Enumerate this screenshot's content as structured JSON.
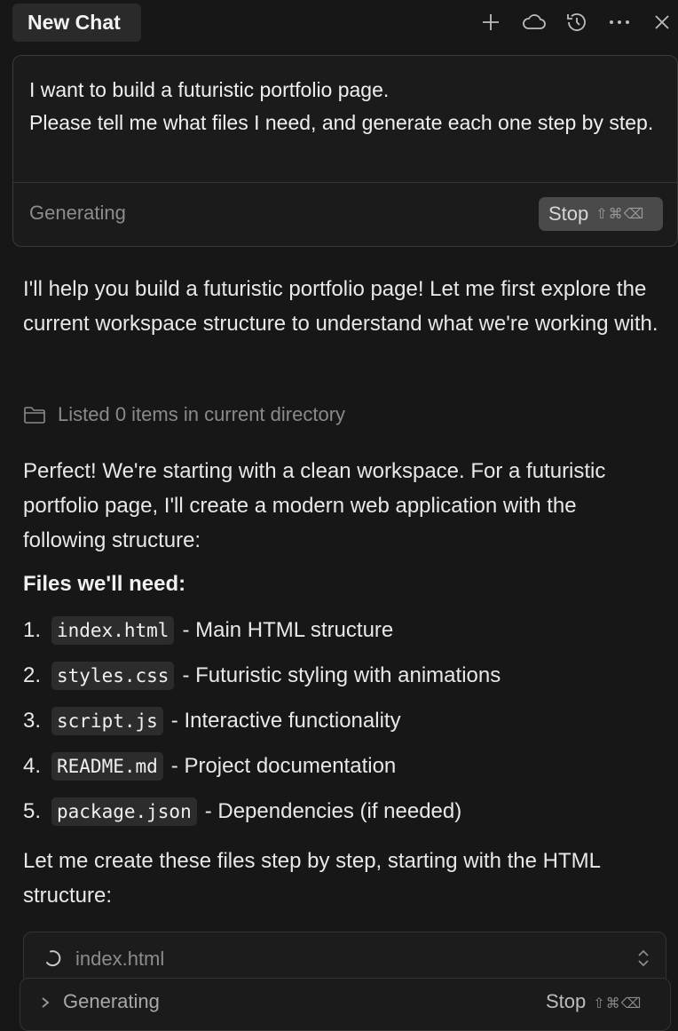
{
  "tab": {
    "title": "New Chat"
  },
  "toolbar": {
    "icons": [
      "plus-icon",
      "cloud-icon",
      "history-icon",
      "more-icon",
      "close-icon"
    ]
  },
  "prompt": {
    "line1": "I want to build a futuristic portfolio page.",
    "line2": "Please tell me what files I need, and generate each one step by step.",
    "status": "Generating",
    "stop_label": "Stop",
    "stop_shortcut": "⇧⌘⌫"
  },
  "response": {
    "intro": "I'll help you build a futuristic portfolio page! Let me first explore the current workspace structure to understand what we're working with.",
    "tool_call": "Listed 0 items in current directory",
    "para2": "Perfect! We're starting with a clean workspace. For a futuristic portfolio page, I'll create a modern web application with the following structure:",
    "files_heading": "Files we'll need:",
    "files": [
      {
        "num": "1.",
        "name": "index.html",
        "desc": "- Main HTML structure"
      },
      {
        "num": "2.",
        "name": "styles.css",
        "desc": "- Futuristic styling with animations"
      },
      {
        "num": "3.",
        "name": "script.js",
        "desc": "- Interactive functionality"
      },
      {
        "num": "4.",
        "name": "README.md",
        "desc": "- Project documentation"
      },
      {
        "num": "5.",
        "name": "package.json",
        "desc": "- Dependencies (if needed)"
      }
    ],
    "para3": "Let me create these files step by step, starting with the HTML structure:"
  },
  "file_card": {
    "filename": "index.html"
  },
  "bottom_bar": {
    "status": "Generating",
    "stop_label": "Stop",
    "stop_shortcut": "⇧⌘⌫"
  }
}
